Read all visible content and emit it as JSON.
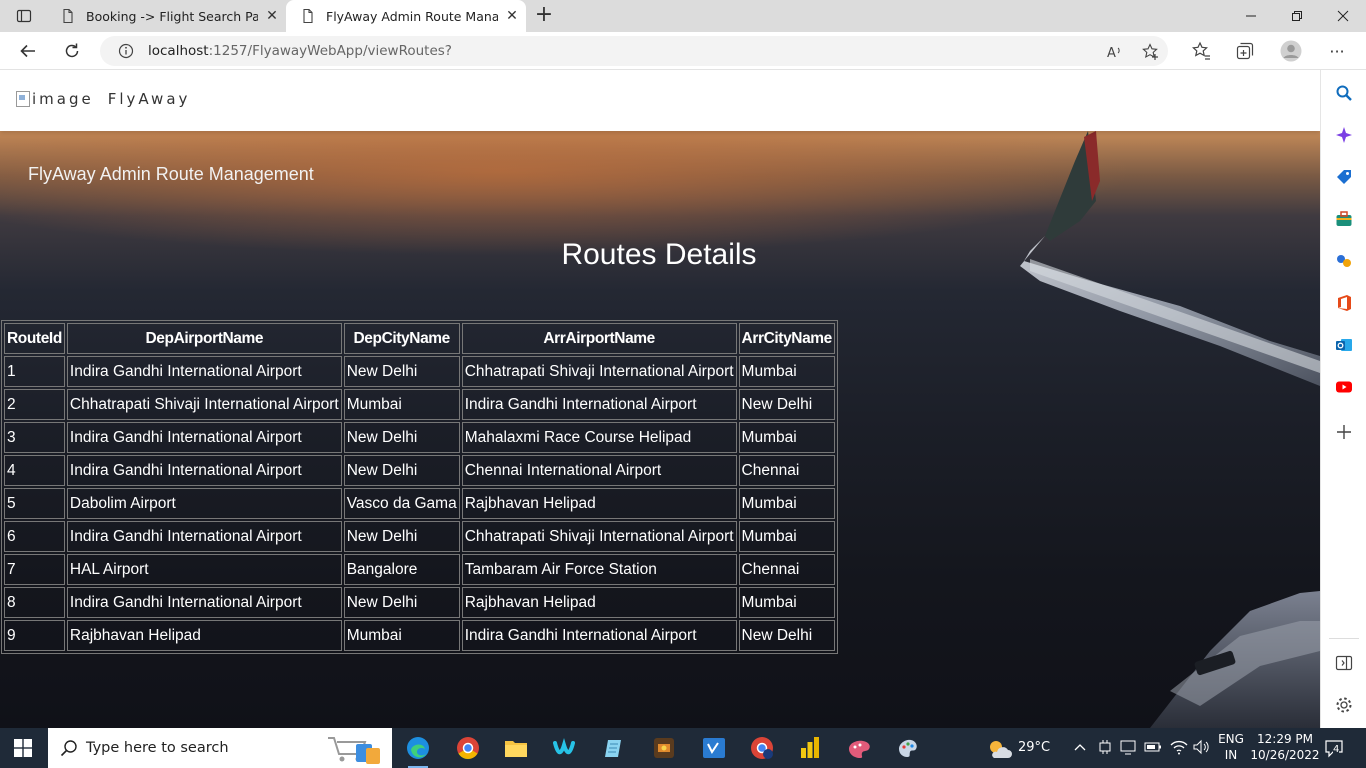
{
  "browser": {
    "tabs": [
      {
        "title": "Booking -> Flight Search Page",
        "close": "✕"
      },
      {
        "title": "FlyAway Admin Route Managem",
        "close": "✕"
      }
    ],
    "new_tab": "+",
    "window_controls": {
      "minimize": "—",
      "restore": "❐",
      "close": "✕"
    },
    "url_host": "localhost",
    "url_rest": ":1257/FlyawayWebApp/viewRoutes?",
    "menu": "···"
  },
  "page": {
    "brand_alt": "image",
    "brand_name": "FlyAway",
    "hero_title": "FlyAway Admin Route Management",
    "heading": "Routes Details",
    "table": {
      "headers": [
        "RouteId",
        "DepAirportName",
        "DepCityName",
        "ArrAirportName",
        "ArrCityName"
      ],
      "rows": [
        [
          "1",
          "Indira Gandhi International Airport",
          "New Delhi",
          "Chhatrapati Shivaji International Airport",
          "Mumbai"
        ],
        [
          "2",
          "Chhatrapati Shivaji International Airport",
          "Mumbai",
          "Indira Gandhi International Airport",
          "New Delhi"
        ],
        [
          "3",
          "Indira Gandhi International Airport",
          "New Delhi",
          "Mahalaxmi Race Course Helipad",
          "Mumbai"
        ],
        [
          "4",
          "Indira Gandhi International Airport",
          "New Delhi",
          "Chennai International Airport",
          "Chennai"
        ],
        [
          "5",
          "Dabolim Airport",
          "Vasco da Gama",
          "Rajbhavan Helipad",
          "Mumbai"
        ],
        [
          "6",
          "Indira Gandhi International Airport",
          "New Delhi",
          "Chhatrapati Shivaji International Airport",
          "Mumbai"
        ],
        [
          "7",
          "HAL Airport",
          "Bangalore",
          "Tambaram Air Force Station",
          "Chennai"
        ],
        [
          "8",
          "Indira Gandhi International Airport",
          "New Delhi",
          "Rajbhavan Helipad",
          "Mumbai"
        ],
        [
          "9",
          "Rajbhavan Helipad",
          "Mumbai",
          "Indira Gandhi International Airport",
          "New Delhi"
        ]
      ]
    }
  },
  "taskbar": {
    "search_placeholder": "Type here to search",
    "weather": "29°C",
    "lang_top": "ENG",
    "lang_bottom": "IN",
    "time": "12:29 PM",
    "date": "10/26/2022",
    "notifications": "4"
  },
  "colors": {
    "edge_blue": "#0f6cbd",
    "taskbar_bg": "#1f2a38",
    "hero_dark": "#1b1e27",
    "hero_sunset": "#c48a58"
  }
}
